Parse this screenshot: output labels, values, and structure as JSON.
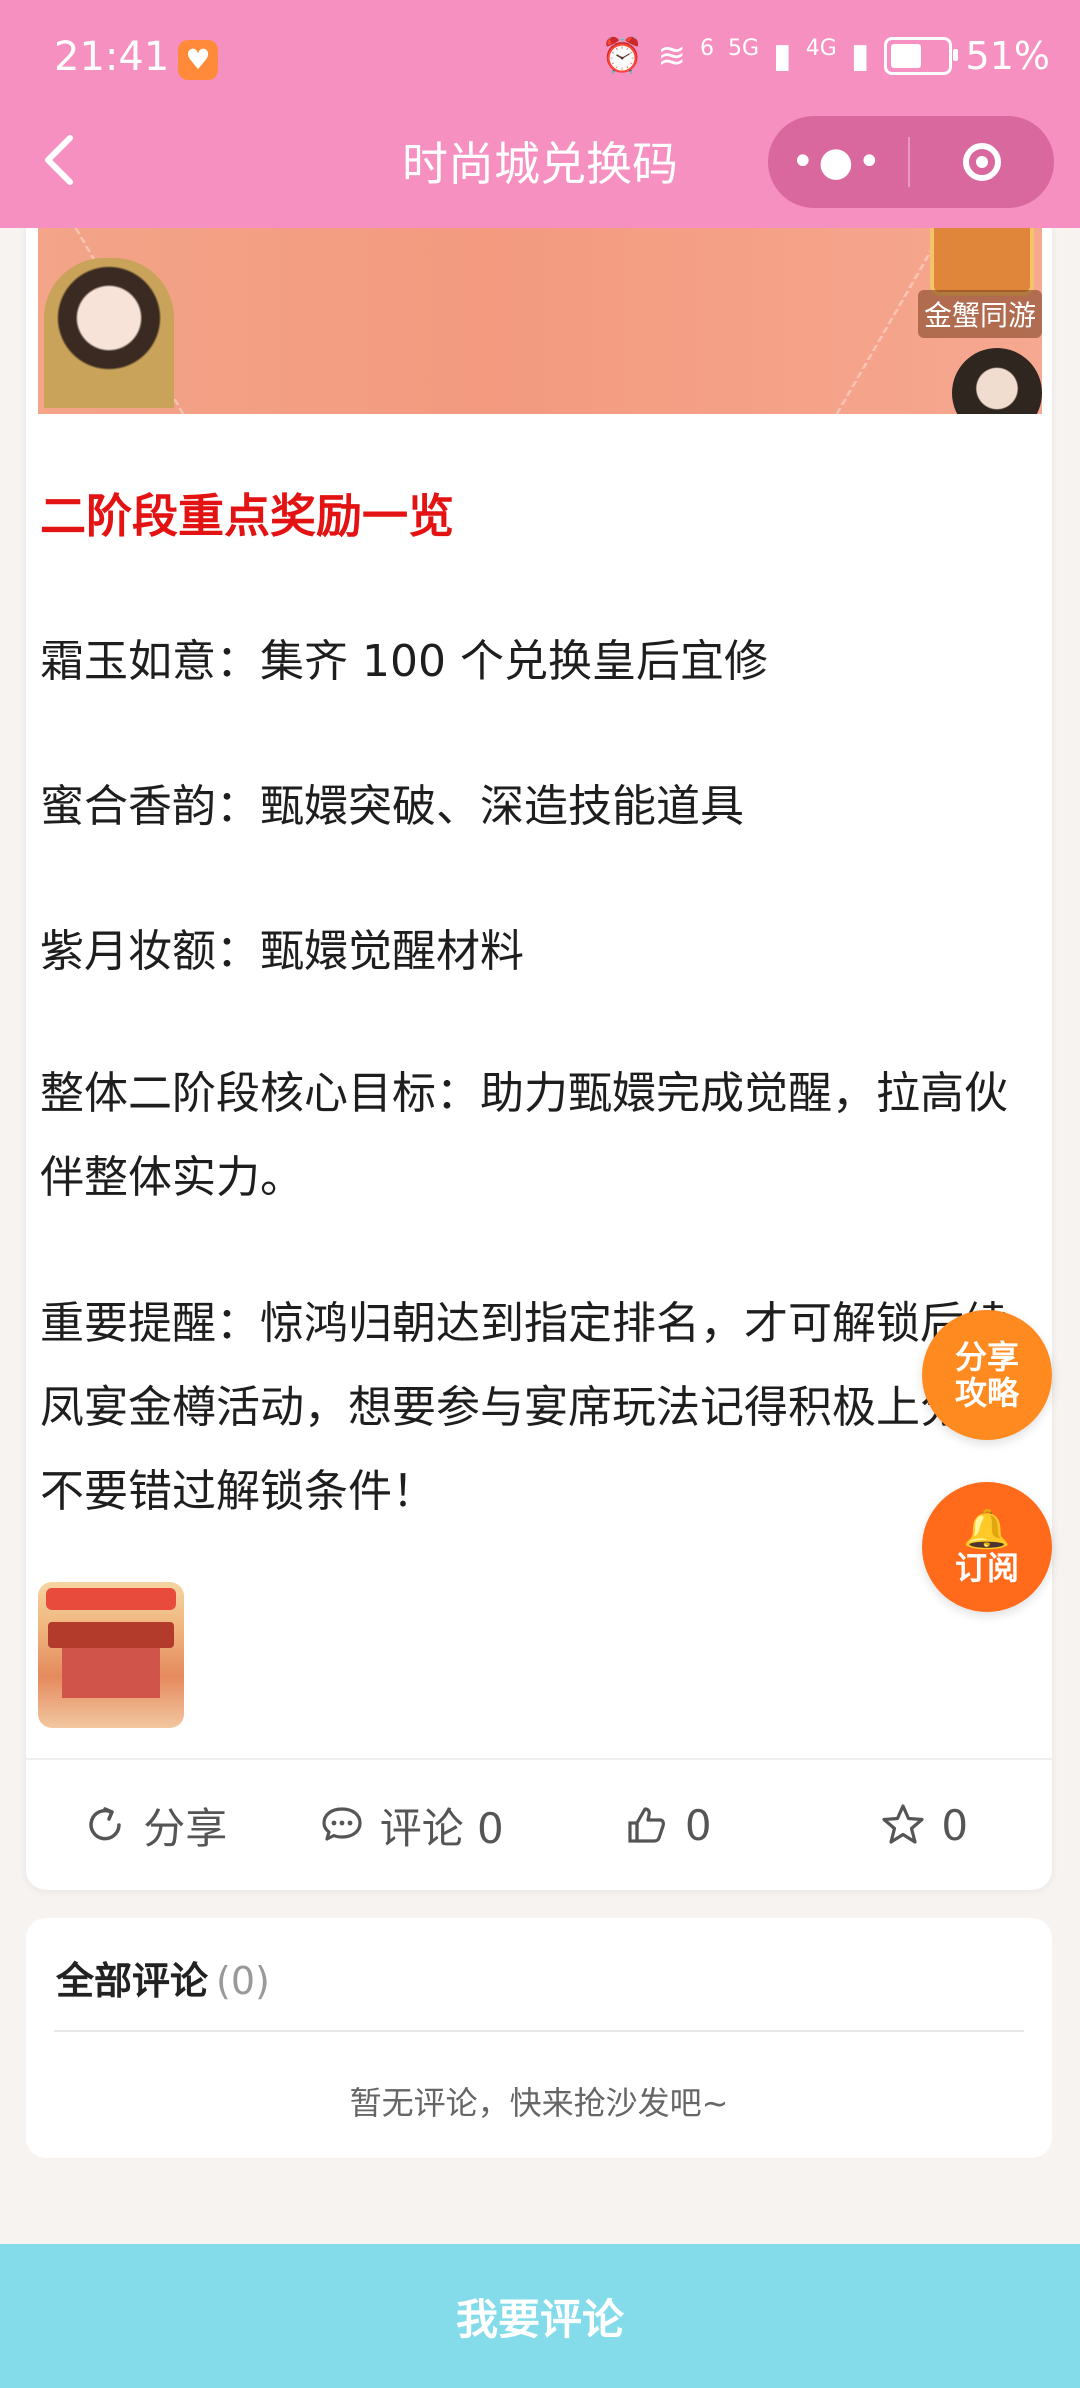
{
  "status_bar": {
    "time": "21:41",
    "network_labels": [
      "6",
      "5G",
      "4G"
    ],
    "battery": "51%"
  },
  "nav": {
    "title": "时尚城兑换码"
  },
  "article": {
    "banner_tag": "金蟹同游",
    "section_title": "二阶段重点奖励一览",
    "paragraphs": [
      "霜玉如意：集齐 100 个兑换皇后宜修",
      "蜜合香韵：甄嬛突破、深造技能道具",
      "紫月妆额：甄嬛觉醒材料",
      "整体二阶段核心目标：助力甄嬛完成觉醒，拉高伙伴整体实力。",
      "重要提醒：惊鸿归朝达到指定排名，才可解锁后续凤宴金樽活动，想要参与宴席玩法记得积极上分，不要错过解锁条件！"
    ]
  },
  "actions": {
    "share_label": "分享",
    "comment_label": "评论 0",
    "like_count": "0",
    "fav_count": "0"
  },
  "comments": {
    "title": "全部评论",
    "count": "(0)",
    "empty_text": "暂无评论，快来抢沙发吧~"
  },
  "floating": {
    "share_line1": "分享",
    "share_line2": "攻略",
    "subscribe_label": "订阅"
  },
  "bottom": {
    "comment_button": "我要评论"
  },
  "colors": {
    "header": "#f590c0",
    "section_title": "#e41313",
    "bottom_bar": "#84dceb",
    "float_orange": "#ff8a1f"
  }
}
